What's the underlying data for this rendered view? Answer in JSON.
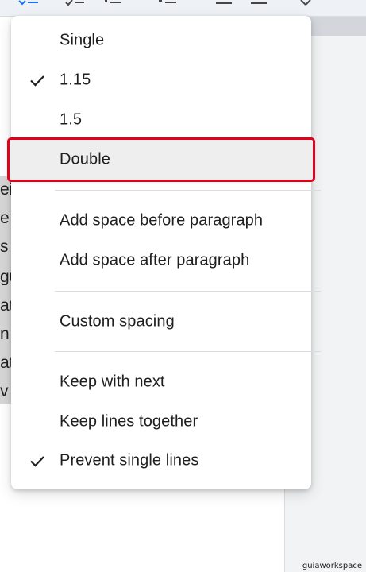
{
  "toolbar": {
    "icons": [
      "line-spacing-icon",
      "checklist-icon",
      "bulleted-list-icon",
      "numbered-list-icon",
      "decrease-indent-icon",
      "increase-indent-icon",
      "clear-formatting-icon"
    ]
  },
  "document": {
    "fragments": [
      "eiu",
      "e",
      "s",
      "gu",
      "at",
      "n",
      "at",
      "v"
    ]
  },
  "menu": {
    "spacing_options": [
      {
        "label": "Single",
        "checked": false
      },
      {
        "label": "1.15",
        "checked": true
      },
      {
        "label": "1.5",
        "checked": false
      },
      {
        "label": "Double",
        "checked": false,
        "highlighted": true
      }
    ],
    "paragraph_options": [
      {
        "label": "Add space before paragraph"
      },
      {
        "label": "Add space after paragraph"
      }
    ],
    "custom": {
      "label": "Custom spacing"
    },
    "pagination_options": [
      {
        "label": "Keep with next",
        "checked": false
      },
      {
        "label": "Keep lines together",
        "checked": false
      },
      {
        "label": "Prevent single lines",
        "checked": true
      }
    ]
  },
  "watermark": "guiaworkspace",
  "colors": {
    "highlight_border": "#e3001b",
    "highlight_fill": "#eeeeee",
    "text": "#1f1f1f",
    "accent": "#1a73e8"
  }
}
